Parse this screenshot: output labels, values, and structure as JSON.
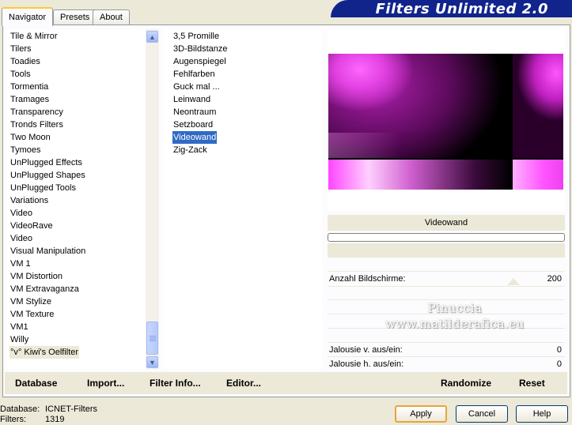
{
  "app": {
    "title": "Filters Unlimited 2.0"
  },
  "tabs": [
    {
      "label": "Navigator",
      "active": true
    },
    {
      "label": "Presets",
      "active": false
    },
    {
      "label": "About",
      "active": false
    }
  ],
  "categories": [
    "Tile & Mirror",
    "Tilers",
    "Toadies",
    "Tools",
    "Tormentia",
    "Tramages",
    "Transparency",
    "Tronds Filters",
    "Two Moon",
    "Tymoes",
    "UnPlugged Effects",
    "UnPlugged Shapes",
    "UnPlugged Tools",
    "Variations",
    "Video",
    "VideoRave",
    "Video",
    "Visual Manipulation",
    "VM 1",
    "VM Distortion",
    "VM Extravaganza",
    "VM Stylize",
    "VM Texture",
    "VM1",
    "Willy",
    "°v° Kiwi's Oelfilter"
  ],
  "selected_category": "°v° Kiwi's Oelfilter",
  "filters": [
    "3,5 Promille",
    "3D-Bildstanze",
    "Augenspiegel",
    "Fehlfarben",
    "Guck mal ...",
    "Leinwand",
    "Neontraum",
    "Setzboard",
    "Videowand",
    "Zig-Zack"
  ],
  "selected_filter": "Videowand",
  "preview": {
    "filter_name": "Videowand",
    "colors": {
      "magenta": "#ff33ff",
      "black": "#000000"
    }
  },
  "parameters": [
    {
      "label": "Anzahl Bildschirme:",
      "value": "200"
    },
    {
      "label": "Jalousie v. aus/ein:",
      "value": "0"
    },
    {
      "label": "Jalousie h. aus/ein:",
      "value": "0"
    }
  ],
  "watermark": {
    "line1": "Pinuccia",
    "line2": "www.matilderafica.eu"
  },
  "bottom_links": {
    "database": "Database",
    "import": "Import...",
    "filter_info": "Filter Info...",
    "editor": "Editor...",
    "randomize": "Randomize",
    "reset": "Reset"
  },
  "status": {
    "database_label": "Database:",
    "database_value": "ICNET-Filters",
    "filters_label": "Filters:",
    "filters_value": "1319"
  },
  "buttons": {
    "apply": "Apply",
    "cancel": "Cancel",
    "help": "Help"
  },
  "icons": {
    "scroll_up": "chevron-up-icon",
    "scroll_down": "chevron-down-icon"
  }
}
